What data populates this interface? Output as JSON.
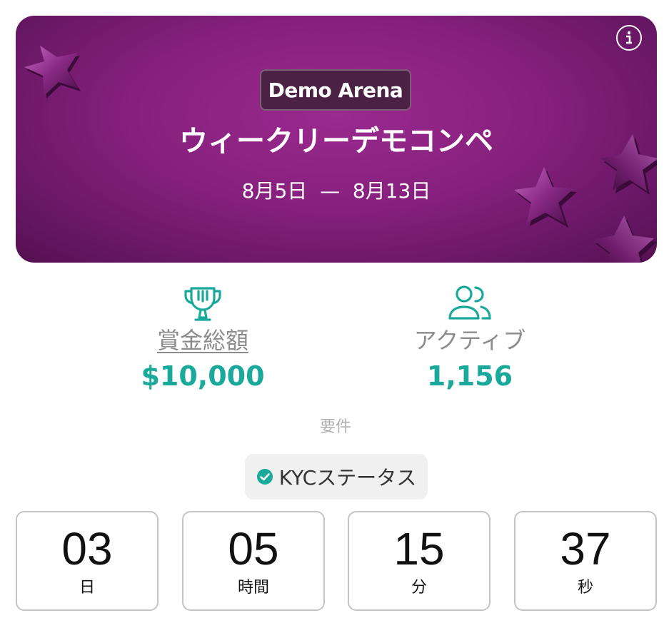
{
  "banner": {
    "badge": "Demo Arena",
    "title": "ウィークリーデモコンペ",
    "dates": "8月5日  —  8月13日"
  },
  "stats": {
    "prize_label": "賞金総額",
    "prize_value": "$10,000",
    "active_label": "アクティブ",
    "active_value": "1,156"
  },
  "requirements": {
    "label": "要件",
    "items": [
      {
        "label": "KYCステータス",
        "icon": "check-circle-icon"
      }
    ]
  },
  "countdown": [
    {
      "value": "03",
      "unit": "日"
    },
    {
      "value": "05",
      "unit": "時間"
    },
    {
      "value": "15",
      "unit": "分"
    },
    {
      "value": "37",
      "unit": "秒"
    }
  ],
  "colors": {
    "accent": "#1aa99a",
    "banner_purple": "#86207d",
    "muted_text": "#8c8c8c"
  },
  "icons": {
    "info": "info-icon",
    "prize": "trophy-icon",
    "active": "users-icon",
    "decoration": "star-icon"
  }
}
